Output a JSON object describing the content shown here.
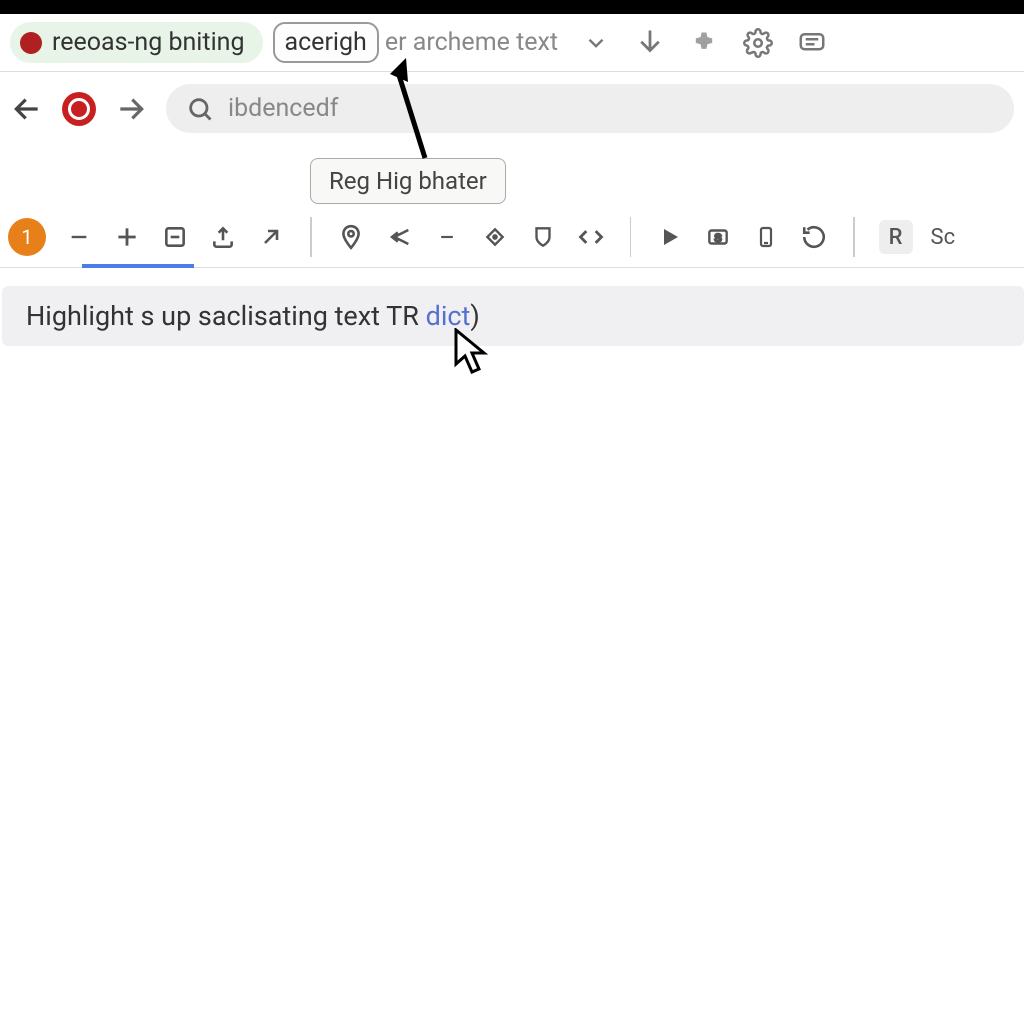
{
  "top": {
    "chip_label": "reeoas-ng bniting",
    "selected_word": "acerigh",
    "faded": "er archeme text"
  },
  "tooltip": {
    "text": "Reg Hig bhater"
  },
  "search": {
    "value": "ibdencedf"
  },
  "toolbar": {
    "badge": "1",
    "r_label": "R",
    "sc_label": "Sc"
  },
  "content": {
    "prefix": "Highlight s up saclisating text TR ",
    "link": "dict",
    "suffix": ")"
  }
}
